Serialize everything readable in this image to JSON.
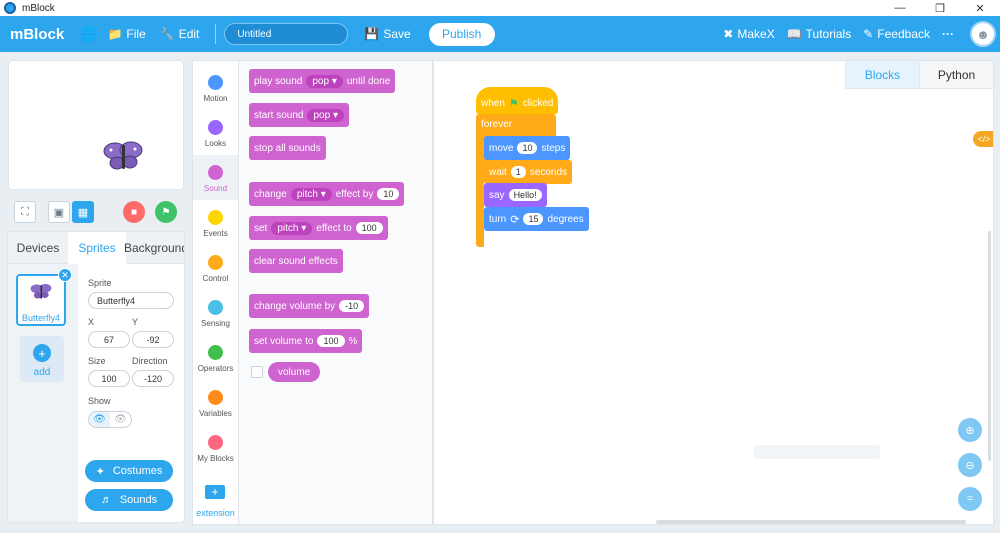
{
  "window": {
    "title": "mBlock",
    "controls": [
      "—",
      "❐",
      "✕"
    ]
  },
  "toolbar": {
    "brand": "mBlock",
    "file_label": "File",
    "edit_label": "Edit",
    "project_name": "Untitled",
    "save_label": "Save",
    "publish_label": "Publish",
    "makex_label": "MakeX",
    "tutorials_label": "Tutorials",
    "feedback_label": "Feedback",
    "more_label": "···"
  },
  "sprite_panel": {
    "tabs": [
      "Devices",
      "Sprites",
      "Background"
    ],
    "active_tab": "Sprites",
    "sprite": {
      "name": "Butterfly4"
    },
    "add_label": "add",
    "props": {
      "sprite_label": "Sprite",
      "sprite_name": "Butterfly4",
      "x_label": "X",
      "y_label": "Y",
      "x": "67",
      "y": "-92",
      "size_label": "Size",
      "direction_label": "Direction",
      "size": "100",
      "direction": "-120",
      "show_label": "Show"
    },
    "costumes_label": "Costumes",
    "sounds_label": "Sounds"
  },
  "categories": [
    {
      "label": "Motion",
      "color": "#4c97ff"
    },
    {
      "label": "Looks",
      "color": "#9966ff"
    },
    {
      "label": "Sound",
      "color": "#cf63cf"
    },
    {
      "label": "Events",
      "color": "#ffd500"
    },
    {
      "label": "Control",
      "color": "#ffab19"
    },
    {
      "label": "Sensing",
      "color": "#4cbfe6"
    },
    {
      "label": "Operators",
      "color": "#40bf4a"
    },
    {
      "label": "Variables",
      "color": "#ff8c1a"
    },
    {
      "label": "My Blocks",
      "color": "#ff6680"
    }
  ],
  "active_category": "Sound",
  "extension_label": "extension",
  "palette": {
    "play_sound": {
      "pre": "play sound",
      "dd": "pop ▾",
      "post": "until done"
    },
    "start_sound": {
      "pre": "start sound",
      "dd": "pop ▾"
    },
    "stop_all": "stop all sounds",
    "change_effect": {
      "pre": "change",
      "dd": "pitch ▾",
      "mid": "effect by",
      "num": "10"
    },
    "set_effect": {
      "pre": "set",
      "dd": "pitch ▾",
      "mid": "effect to",
      "num": "100"
    },
    "clear_effects": "clear sound effects",
    "change_volume": {
      "pre": "change volume by",
      "num": "-10"
    },
    "set_volume": {
      "pre": "set volume to",
      "num": "100",
      "post": "%"
    },
    "volume_reporter": "volume"
  },
  "script": {
    "hat": {
      "pre": "when",
      "post": "clicked"
    },
    "forever": "forever",
    "move": {
      "pre": "move",
      "num": "10",
      "post": "steps"
    },
    "wait": {
      "pre": "wait",
      "num": "1",
      "post": "seconds"
    },
    "say": {
      "pre": "say",
      "num": "Hello!"
    },
    "turn": {
      "pre": "turn",
      "num": "15",
      "post": "degrees"
    }
  },
  "code_tabs": [
    "Blocks",
    "Python"
  ],
  "active_code_tab": "Blocks",
  "colors": {
    "accent": "#2ea6ee",
    "sound": "#cf63cf",
    "motion": "#4c97ff",
    "control": "#ffab19",
    "events": "#ffbf00",
    "looks": "#9966ff"
  }
}
